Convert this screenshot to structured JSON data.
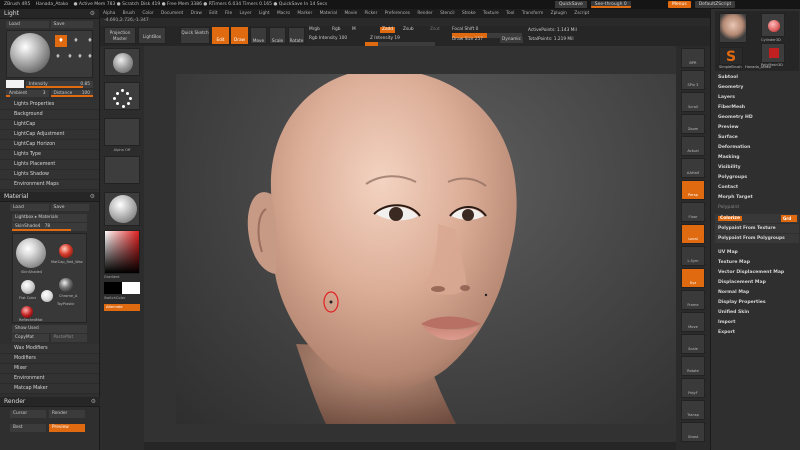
{
  "titlebar": {
    "app": "ZBrush 4R5",
    "file": "Hanada_Atako",
    "stats": "● Active Mem 783 ● Scratch Disk 419 ● Free Mem 3386 ● RTimers 6.034 Timers 0.165 ● QuickSave In 14 Secs",
    "quicksave": "QuickSave",
    "seethrough": "See-through 0",
    "menus_btn": "Menus",
    "script_btn": "DefaultZScript"
  },
  "menubar": [
    "Alpha",
    "Brush",
    "Color",
    "Document",
    "Draw",
    "Edit",
    "File",
    "Layer",
    "Light",
    "Macro",
    "Marker",
    "Material",
    "Movie",
    "Picker",
    "Preferences",
    "Render",
    "Stencil",
    "Stroke",
    "Texture",
    "Tool",
    "Transform",
    "Zplugin",
    "Zscript"
  ],
  "coords": "-4.691,2.726,-1.347",
  "left": {
    "light": {
      "title": "Light",
      "tab_load": "Load",
      "tab_save": "Save",
      "intensity_label": "Intensity",
      "intensity_value": "0.85",
      "ambient_label": "Ambient",
      "ambient_value": "3",
      "distance_label": "Distance",
      "distance_value": "100"
    },
    "light_items": [
      "Lights Properties",
      "Background",
      "LightCap",
      "LightCap Adjustment",
      "LightCap Horizon",
      "Lights Type",
      "Lights Placement",
      "Lights Shadow",
      "Environment Maps"
    ],
    "material": {
      "title": "Material",
      "tab_load": "Load",
      "tab_save": "Save",
      "lightbox": "Lightbox ▸ Materials",
      "current": "SkinShade4",
      "current_value": "78",
      "labels": [
        "SkinShade4",
        "MatCap_Red_Wax",
        "Flat Color",
        "Chrome_A",
        "ToyPlastic",
        "ReflectedMat"
      ],
      "show_used": "Show Used",
      "copy": "CopyMat",
      "paste": "PasteMat"
    },
    "material_items": [
      "Wax Modifiers",
      "Modifiers",
      "Mixer",
      "Environment",
      "Matcap Maker"
    ],
    "render": {
      "title": "Render",
      "cursor": "Cursor",
      "render_btn": "Render",
      "best": "Best",
      "preview": "Preview"
    }
  },
  "toolbar": {
    "projection_master": "Projection Master",
    "lightbox": "LightBox",
    "quick_sketch": "Quick Sketch",
    "edit": "Edit",
    "draw": "Draw",
    "move": "Move",
    "scale": "Scale",
    "rotate": "Rotate",
    "mrgb": "Mrgb",
    "rgb": "Rgb",
    "m": "M",
    "rgb_intensity_label": "Rgb Intensity",
    "rgb_intensity_value": "100",
    "zadd": "Zadd",
    "zsub": "Zsub",
    "zcut": "Zcut",
    "z_intensity_label": "Z Intensity",
    "z_intensity_value": "19",
    "focal_shift_label": "Focal Shift",
    "focal_shift_value": "0",
    "draw_size_label": "Draw Size",
    "draw_size_value": "257",
    "dynamic": "Dynamic",
    "active_points": "ActivePoints: 1.143 Mil",
    "total_points": "TotalPoints: 1.219 Mil"
  },
  "shelf": {
    "labels": [
      "Standard",
      "DragDot",
      "Alpha Off",
      "Texture Off",
      "SkinShade4"
    ],
    "gradient": "Gradient",
    "switch_color": "SwitchColor",
    "alternate": "Alternate"
  },
  "rtools": [
    "BPR",
    "SPix 3",
    "Scroll",
    "Zoom",
    "Actual",
    "AAHalf",
    "Persp",
    "Floor",
    "Local",
    "L.Sym",
    "Xyz",
    "Frame",
    "Move",
    "Scale",
    "Rotate",
    "PolyF",
    "Transp",
    "Ghost",
    "Solo",
    "Xpose"
  ],
  "right": {
    "thumbs": [
      "Cylinder3D",
      "PolyMesh3D",
      "SimpleBrush",
      "Hanada_Atako"
    ],
    "items": [
      "Subtool",
      "Geometry",
      "Layers",
      "FiberMesh",
      "Geometry HD",
      "Preview",
      "Surface",
      "Deformation",
      "Masking",
      "Visibility",
      "Polygroups",
      "Contact",
      "Morph Target",
      "Polypaint"
    ],
    "polypaint_sub": {
      "colorize": "Colorize",
      "grd": "Grd",
      "from_texture": "Polypaint From Texture",
      "from_polygroups": "Polypaint From Polygroups"
    },
    "items2": [
      "UV Map",
      "Texture Map",
      "Vector Displacement Map",
      "Displacement Map",
      "Normal Map",
      "Display Properties",
      "Unified Skin",
      "Import",
      "Export"
    ]
  },
  "colors": {
    "accent": "#e06a10",
    "panel": "#2f2f2f"
  }
}
